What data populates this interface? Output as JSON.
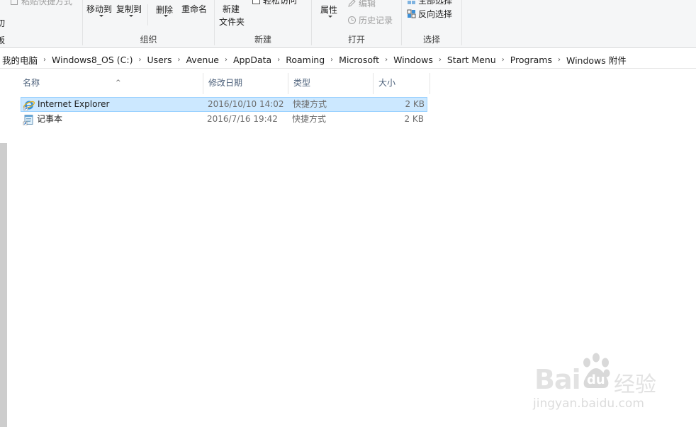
{
  "ribbon": {
    "clipboard": {
      "paste_shortcut_label": "粘贴快捷方式",
      "cut_label": "切",
      "group_label": "板"
    },
    "organize": {
      "move_to_label": "移动到",
      "copy_to_label": "复制到",
      "delete_label": "删除",
      "rename_label": "重命名",
      "group_label": "组织"
    },
    "new": {
      "new_folder_label_line1": "新建",
      "new_folder_label_line2": "文件夹",
      "easy_access_label": "轻松访问",
      "group_label": "新建"
    },
    "open": {
      "properties_label": "属性",
      "edit_label": "编辑",
      "history_label": "历史记录",
      "group_label": "打开"
    },
    "select": {
      "select_all_label": "全部选择",
      "invert_selection_label": "反向选择",
      "group_label": "选择"
    }
  },
  "address": {
    "crumbs": [
      "我的电脑",
      "Windows8_OS (C:)",
      "Users",
      "Avenue",
      "AppData",
      "Roaming",
      "Microsoft",
      "Windows",
      "Start Menu",
      "Programs",
      "Windows 附件"
    ]
  },
  "columns": {
    "name": "名称",
    "date": "修改日期",
    "type": "类型",
    "size": "大小",
    "sort_indicator": "^"
  },
  "files": [
    {
      "name": "Internet Explorer",
      "date": "2016/10/10 14:02",
      "type": "快捷方式",
      "size": "2 KB",
      "icon": "internet-explorer-icon",
      "selected": true
    },
    {
      "name": "记事本",
      "date": "2016/7/16 19:42",
      "type": "快捷方式",
      "size": "2 KB",
      "icon": "notepad-icon",
      "selected": false
    }
  ],
  "watermark": {
    "brand": "Bai",
    "brand_suffix": "du",
    "product": "经验",
    "url": "jingyan.baidu.com"
  },
  "colors": {
    "selection_bg": "#cce8ff",
    "selection_border": "#99d1ff",
    "header_text": "#4c607a",
    "ribbon_bg": "#f5f6f7"
  }
}
